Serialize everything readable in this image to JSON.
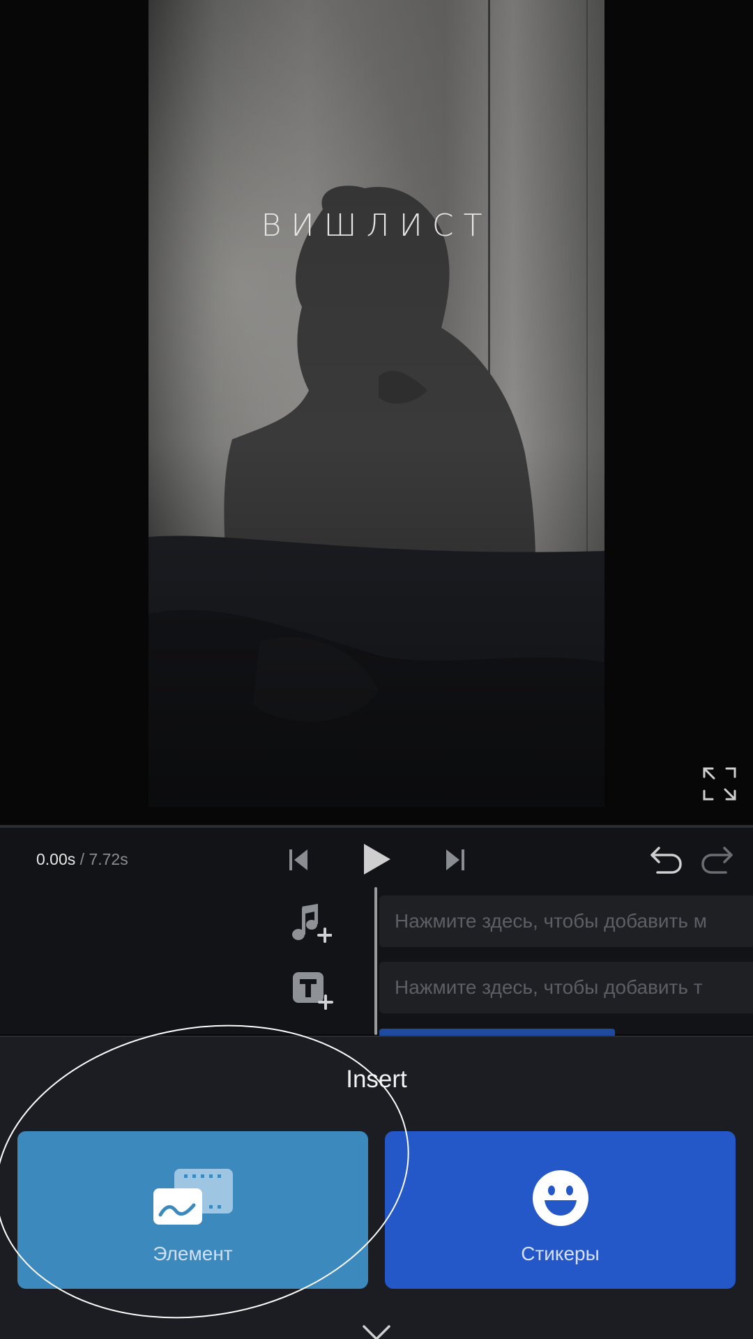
{
  "preview": {
    "overlay_text": "ВИШЛИСТ",
    "fullscreen_icon": "expand-icon"
  },
  "player": {
    "current_time": "0.00s",
    "separator": " / ",
    "total_time": "7.72s",
    "icons": [
      "skip-back-icon",
      "play-icon",
      "skip-forward-icon",
      "undo-icon",
      "redo-icon"
    ]
  },
  "timeline": {
    "music_track_placeholder": "Нажмите здесь, чтобы добавить м",
    "text_track_placeholder": "Нажмите здесь, чтобы добавить т",
    "icons": [
      "add-music-icon",
      "add-text-icon"
    ]
  },
  "insert_sheet": {
    "title": "Insert",
    "options": [
      {
        "label": "Элемент",
        "icon": "media-element-icon",
        "color": "#3c89bd"
      },
      {
        "label": "Стикеры",
        "icon": "smiley-icon",
        "color": "#2457c8"
      }
    ],
    "close_icon": "close-icon"
  },
  "colors": {
    "background": "#070707",
    "panel": "#121316",
    "sheet": "#1b1d22",
    "accent_blue": "#2457c8",
    "accent_light_blue": "#3c89bd"
  }
}
